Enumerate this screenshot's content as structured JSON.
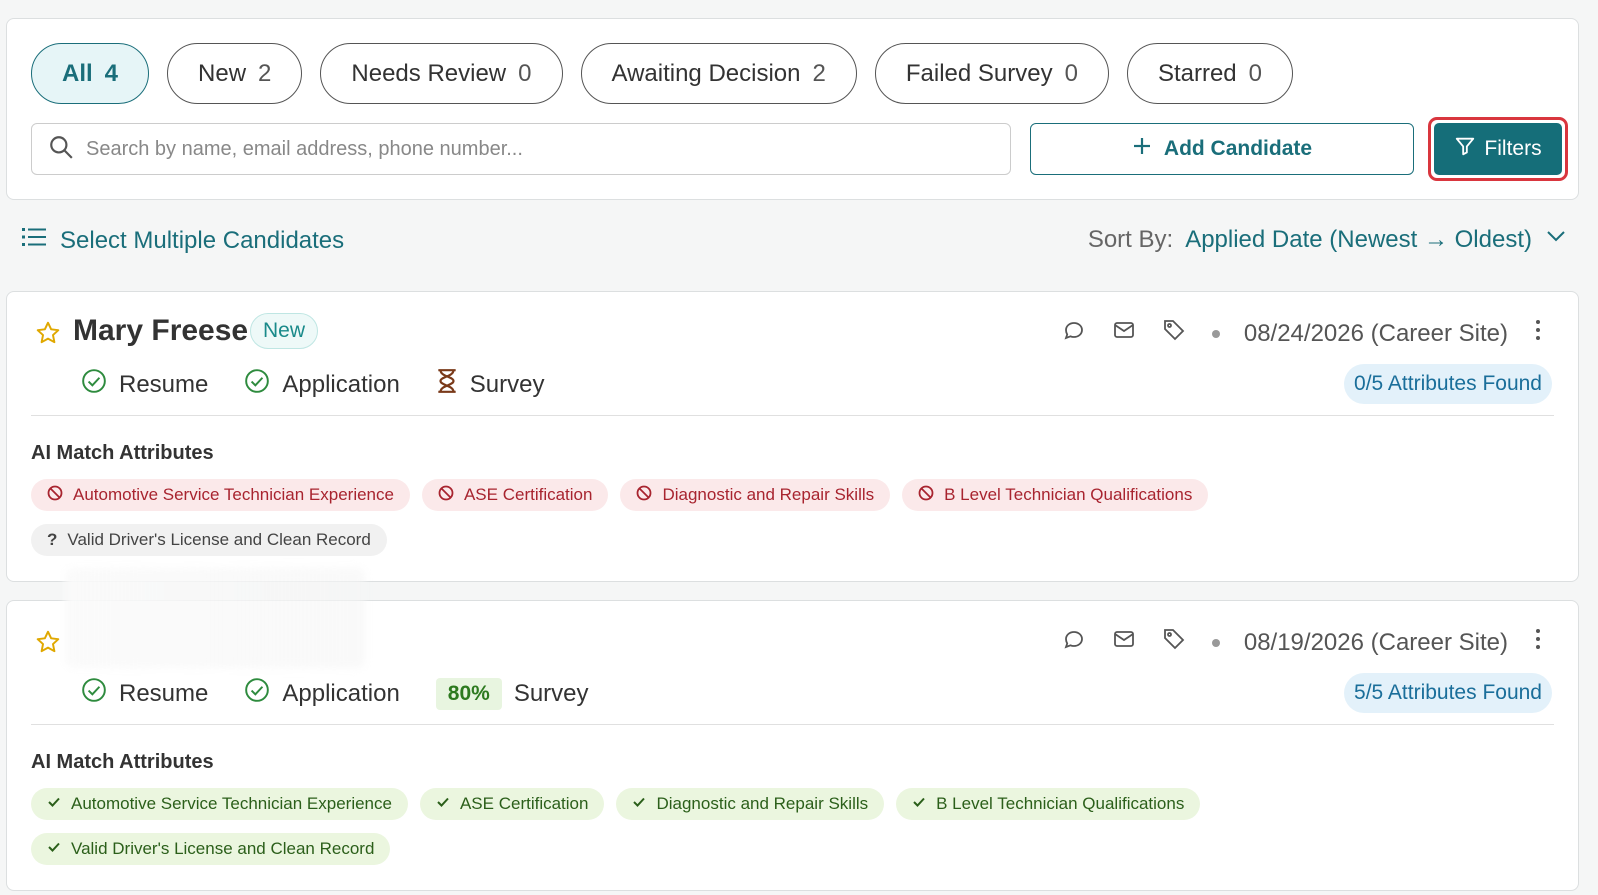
{
  "tabs": [
    {
      "label": "All",
      "count": "4"
    },
    {
      "label": "New",
      "count": "2"
    },
    {
      "label": "Needs Review",
      "count": "0"
    },
    {
      "label": "Awaiting Decision",
      "count": "2"
    },
    {
      "label": "Failed Survey",
      "count": "0"
    },
    {
      "label": "Starred",
      "count": "0"
    }
  ],
  "search": {
    "placeholder": "Search by name, email address, phone number..."
  },
  "toolbar": {
    "add_label": "Add Candidate",
    "filters_label": "Filters"
  },
  "select_multiple_label": "Select Multiple Candidates",
  "sort": {
    "label": "Sort By:",
    "value": "Applied Date (Newest → Oldest)"
  },
  "candidates": [
    {
      "name": "Mary Freese",
      "badge": "New",
      "date": "08/24/2026 (Career Site)",
      "steps": {
        "resume": "Resume",
        "application": "Application",
        "survey": "Survey"
      },
      "attributes_found": "0/5 Attributes Found",
      "ai_title": "AI Match Attributes",
      "attributes": [
        {
          "label": "Automotive Service Technician Experience",
          "status": "no"
        },
        {
          "label": "ASE Certification",
          "status": "no"
        },
        {
          "label": "Diagnostic and Repair Skills",
          "status": "no"
        },
        {
          "label": "B Level Technician Qualifications",
          "status": "no"
        },
        {
          "label": "Valid Driver's License and Clean Record",
          "status": "unknown"
        }
      ]
    },
    {
      "name": "",
      "date": "08/19/2026 (Career Site)",
      "steps": {
        "resume": "Resume",
        "application": "Application",
        "survey": "Survey",
        "survey_score": "80%"
      },
      "attributes_found": "5/5 Attributes Found",
      "ai_title": "AI Match Attributes",
      "attributes": [
        {
          "label": "Automotive Service Technician Experience",
          "status": "yes"
        },
        {
          "label": "ASE Certification",
          "status": "yes"
        },
        {
          "label": "Diagnostic and Repair Skills",
          "status": "yes"
        },
        {
          "label": "B Level Technician Qualifications",
          "status": "yes"
        },
        {
          "label": "Valid Driver's License and Clean Record",
          "status": "yes"
        }
      ]
    }
  ],
  "colors": {
    "accent": "#1a6e7a",
    "filter_bg": "#156e79",
    "highlight": "#d9363e"
  }
}
